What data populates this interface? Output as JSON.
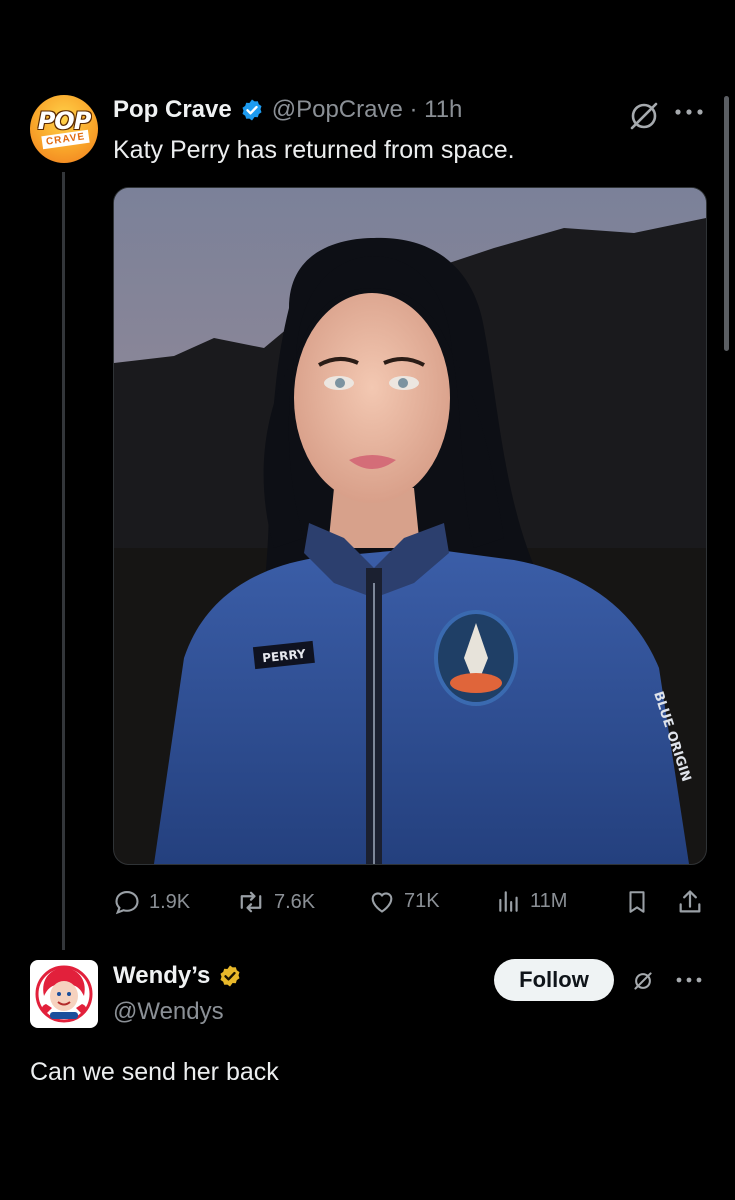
{
  "tweet": {
    "author_name": "Pop Crave",
    "author_handle": "@PopCrave · 11h",
    "avatar_text": "POP",
    "avatar_sub": "CRAVE",
    "text": "Katy Perry has returned from space.",
    "media": {
      "name_tag": "PERRY",
      "sleeve_text": "BLUE ORIGIN"
    },
    "stats": {
      "replies": "1.9K",
      "reposts": "7.6K",
      "likes": "71K",
      "views": "11M"
    }
  },
  "reply": {
    "author_name": "Wendy’s",
    "author_handle": "@Wendys",
    "follow_label": "Follow",
    "text": "Can we send her back"
  },
  "colors": {
    "background": "#000000",
    "verified_blue": "#1d9bf0",
    "verified_gold": "#e8b82a",
    "follow_bg": "#eff3f4"
  }
}
